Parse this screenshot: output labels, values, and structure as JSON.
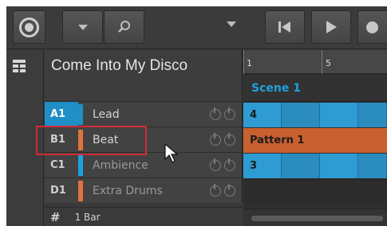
{
  "header": {
    "project_title": "Come Into My Disco"
  },
  "toolbar": {
    "logo_icon": "maschine-logo-icon",
    "dropdown_icon": "chevron-down-icon",
    "search_icon": "search-icon",
    "prev_icon": "skip-back-icon",
    "play_icon": "play-icon",
    "record_icon": "record-icon"
  },
  "groups": [
    {
      "id": "A1",
      "name": "Lead",
      "color": "#1e8fc7",
      "active": true
    },
    {
      "id": "B1",
      "name": "Beat",
      "color": "#e0733a",
      "active": false
    },
    {
      "id": "C1",
      "name": "Ambience",
      "color": "#1ea2de",
      "active": false
    },
    {
      "id": "D1",
      "name": "Extra Drums",
      "color": "#e0733a",
      "active": false
    }
  ],
  "footer": {
    "hash": "#",
    "bar_length": "1 Bar"
  },
  "arranger": {
    "ruler": [
      "1",
      "5"
    ],
    "scene_label": "Scene 1",
    "clip_a": "4",
    "clip_b": "Pattern 1",
    "clip_c": "3"
  },
  "colors": {
    "accent_blue": "#1ea2de",
    "accent_orange": "#d4683a",
    "highlight_red": "#d42a35"
  }
}
